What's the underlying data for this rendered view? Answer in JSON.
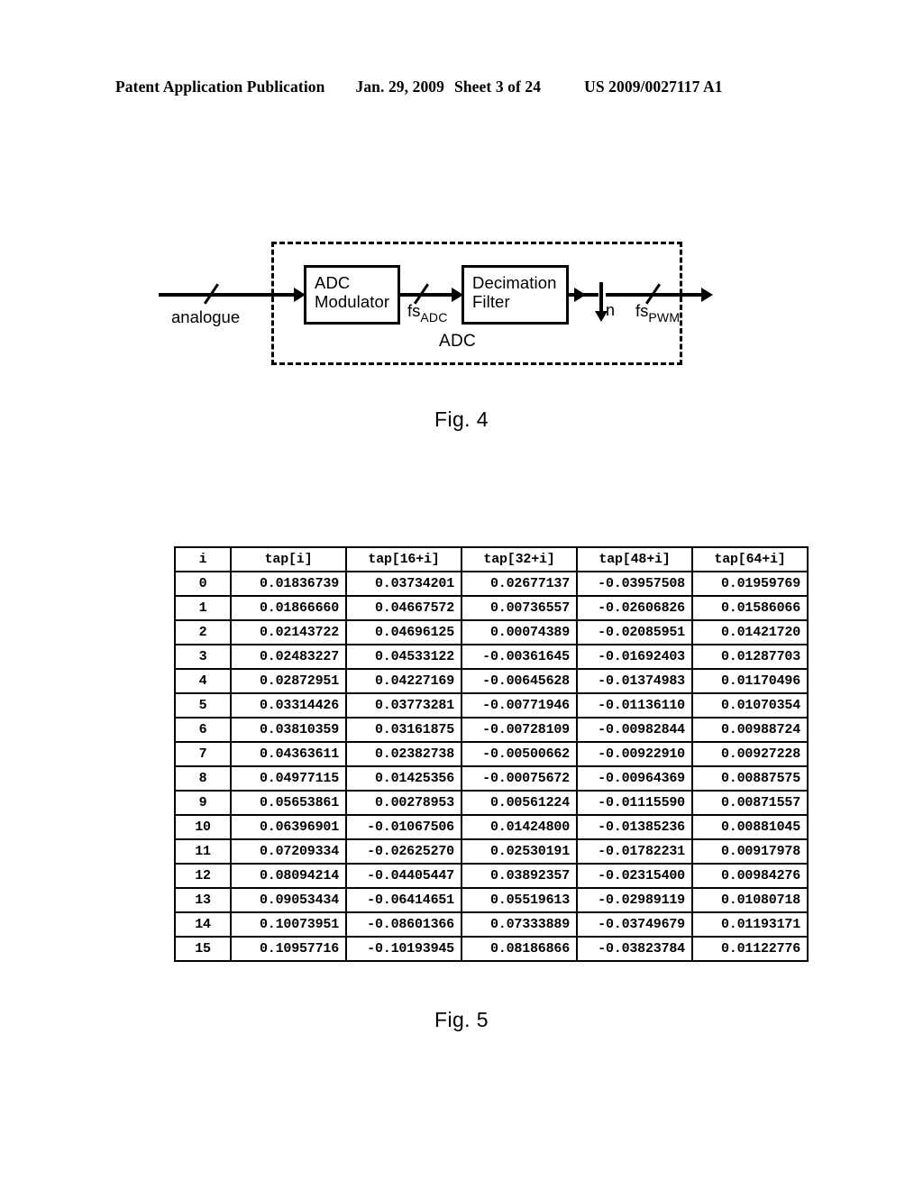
{
  "header": {
    "publication": "Patent Application Publication",
    "date": "Jan. 29, 2009",
    "sheet": "Sheet 3 of 24",
    "patent_number": "US 2009/0027117 A1"
  },
  "figure4": {
    "caption": "Fig. 4",
    "enclosure_label": "ADC",
    "input_label": "analogue",
    "blocks": [
      {
        "id": "adc_modulator",
        "line1": "ADC",
        "line2": "Modulator"
      },
      {
        "id": "decimation_filter",
        "line1": "Decimation",
        "line2": "Filter"
      }
    ],
    "signal_labels": {
      "fs_adc_base": "fs",
      "fs_adc_sub": "ADC",
      "fs_pwm_base": "fs",
      "fs_pwm_sub": "PWM",
      "decimation_factor": "n"
    }
  },
  "figure5": {
    "caption": "Fig. 5",
    "columns": [
      "i",
      "tap[i]",
      "tap[16+i]",
      "tap[32+i]",
      "tap[48+i]",
      "tap[64+i]"
    ],
    "rows": [
      [
        "0",
        "0.01836739",
        "0.03734201",
        "0.02677137",
        "-0.03957508",
        "0.01959769"
      ],
      [
        "1",
        "0.01866660",
        "0.04667572",
        "0.00736557",
        "-0.02606826",
        "0.01586066"
      ],
      [
        "2",
        "0.02143722",
        "0.04696125",
        "0.00074389",
        "-0.02085951",
        "0.01421720"
      ],
      [
        "3",
        "0.02483227",
        "0.04533122",
        "-0.00361645",
        "-0.01692403",
        "0.01287703"
      ],
      [
        "4",
        "0.02872951",
        "0.04227169",
        "-0.00645628",
        "-0.01374983",
        "0.01170496"
      ],
      [
        "5",
        "0.03314426",
        "0.03773281",
        "-0.00771946",
        "-0.01136110",
        "0.01070354"
      ],
      [
        "6",
        "0.03810359",
        "0.03161875",
        "-0.00728109",
        "-0.00982844",
        "0.00988724"
      ],
      [
        "7",
        "0.04363611",
        "0.02382738",
        "-0.00500662",
        "-0.00922910",
        "0.00927228"
      ],
      [
        "8",
        "0.04977115",
        "0.01425356",
        "-0.00075672",
        "-0.00964369",
        "0.00887575"
      ],
      [
        "9",
        "0.05653861",
        "0.00278953",
        "0.00561224",
        "-0.01115590",
        "0.00871557"
      ],
      [
        "10",
        "0.06396901",
        "-0.01067506",
        "0.01424800",
        "-0.01385236",
        "0.00881045"
      ],
      [
        "11",
        "0.07209334",
        "-0.02625270",
        "0.02530191",
        "-0.01782231",
        "0.00917978"
      ],
      [
        "12",
        "0.08094214",
        "-0.04405447",
        "0.03892357",
        "-0.02315400",
        "0.00984276"
      ],
      [
        "13",
        "0.09053434",
        "-0.06414651",
        "0.05519613",
        "-0.02989119",
        "0.01080718"
      ],
      [
        "14",
        "0.10073951",
        "-0.08601366",
        "0.07333889",
        "-0.03749679",
        "0.01193171"
      ],
      [
        "15",
        "0.10957716",
        "-0.10193945",
        "0.08186866",
        "-0.03823784",
        "0.01122776"
      ]
    ]
  }
}
